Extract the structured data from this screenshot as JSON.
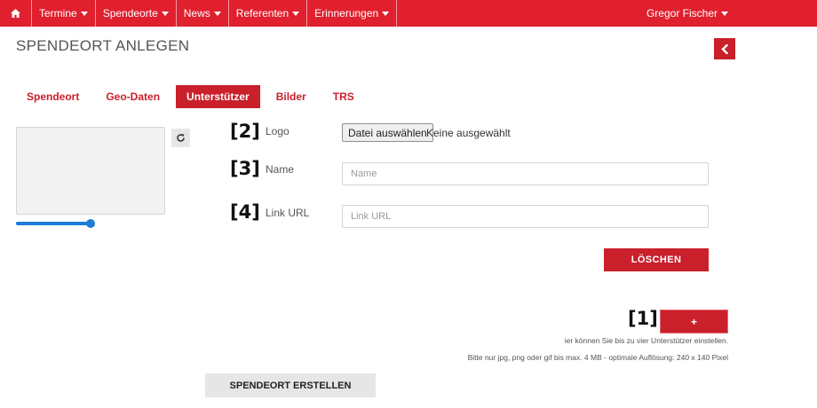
{
  "navbar": {
    "items": [
      {
        "label": "Termine"
      },
      {
        "label": "Spendeorte"
      },
      {
        "label": "News"
      },
      {
        "label": "Referenten"
      },
      {
        "label": "Erinnerungen"
      }
    ],
    "user": "Gregor Fischer",
    "home_icon": "home-icon"
  },
  "page": {
    "title": "SPENDEORT ANLEGEN",
    "back_icon": "chevron-left-icon"
  },
  "tabs": [
    {
      "label": "Spendeort",
      "active": false
    },
    {
      "label": "Geo-Daten",
      "active": false
    },
    {
      "label": "Unterstützer",
      "active": true
    },
    {
      "label": "Bilder",
      "active": false
    },
    {
      "label": "TRS",
      "active": false
    }
  ],
  "image_editor": {
    "refresh_icon": "refresh-icon",
    "zoom_level": 1.0
  },
  "markers": {
    "m1": "[1]",
    "m2": "[2]",
    "m3": "[3]",
    "m4": "[4]"
  },
  "form": {
    "logo_label": "Logo",
    "file_button": "Datei auswählen",
    "file_status": "Keine ausgewählt",
    "name_label": "Name",
    "name_placeholder": "Name",
    "link_label": "Link URL",
    "link_placeholder": "Link URL",
    "delete_button": "LÖSCHEN",
    "add_button": "+",
    "hint_1": "ier können Sie bis zu vier Unterstützer einstellen.",
    "hint_2": "Bitte nur jpg, png oder gif bis max. 4 MB - optimale Auflösung: 240 x 140 Pixel",
    "submit_button": "SPENDEORT ERSTELLEN"
  },
  "colors": {
    "navbar": "#e0202e",
    "accent": "#c9202b",
    "slider": "#1e7bd8"
  }
}
